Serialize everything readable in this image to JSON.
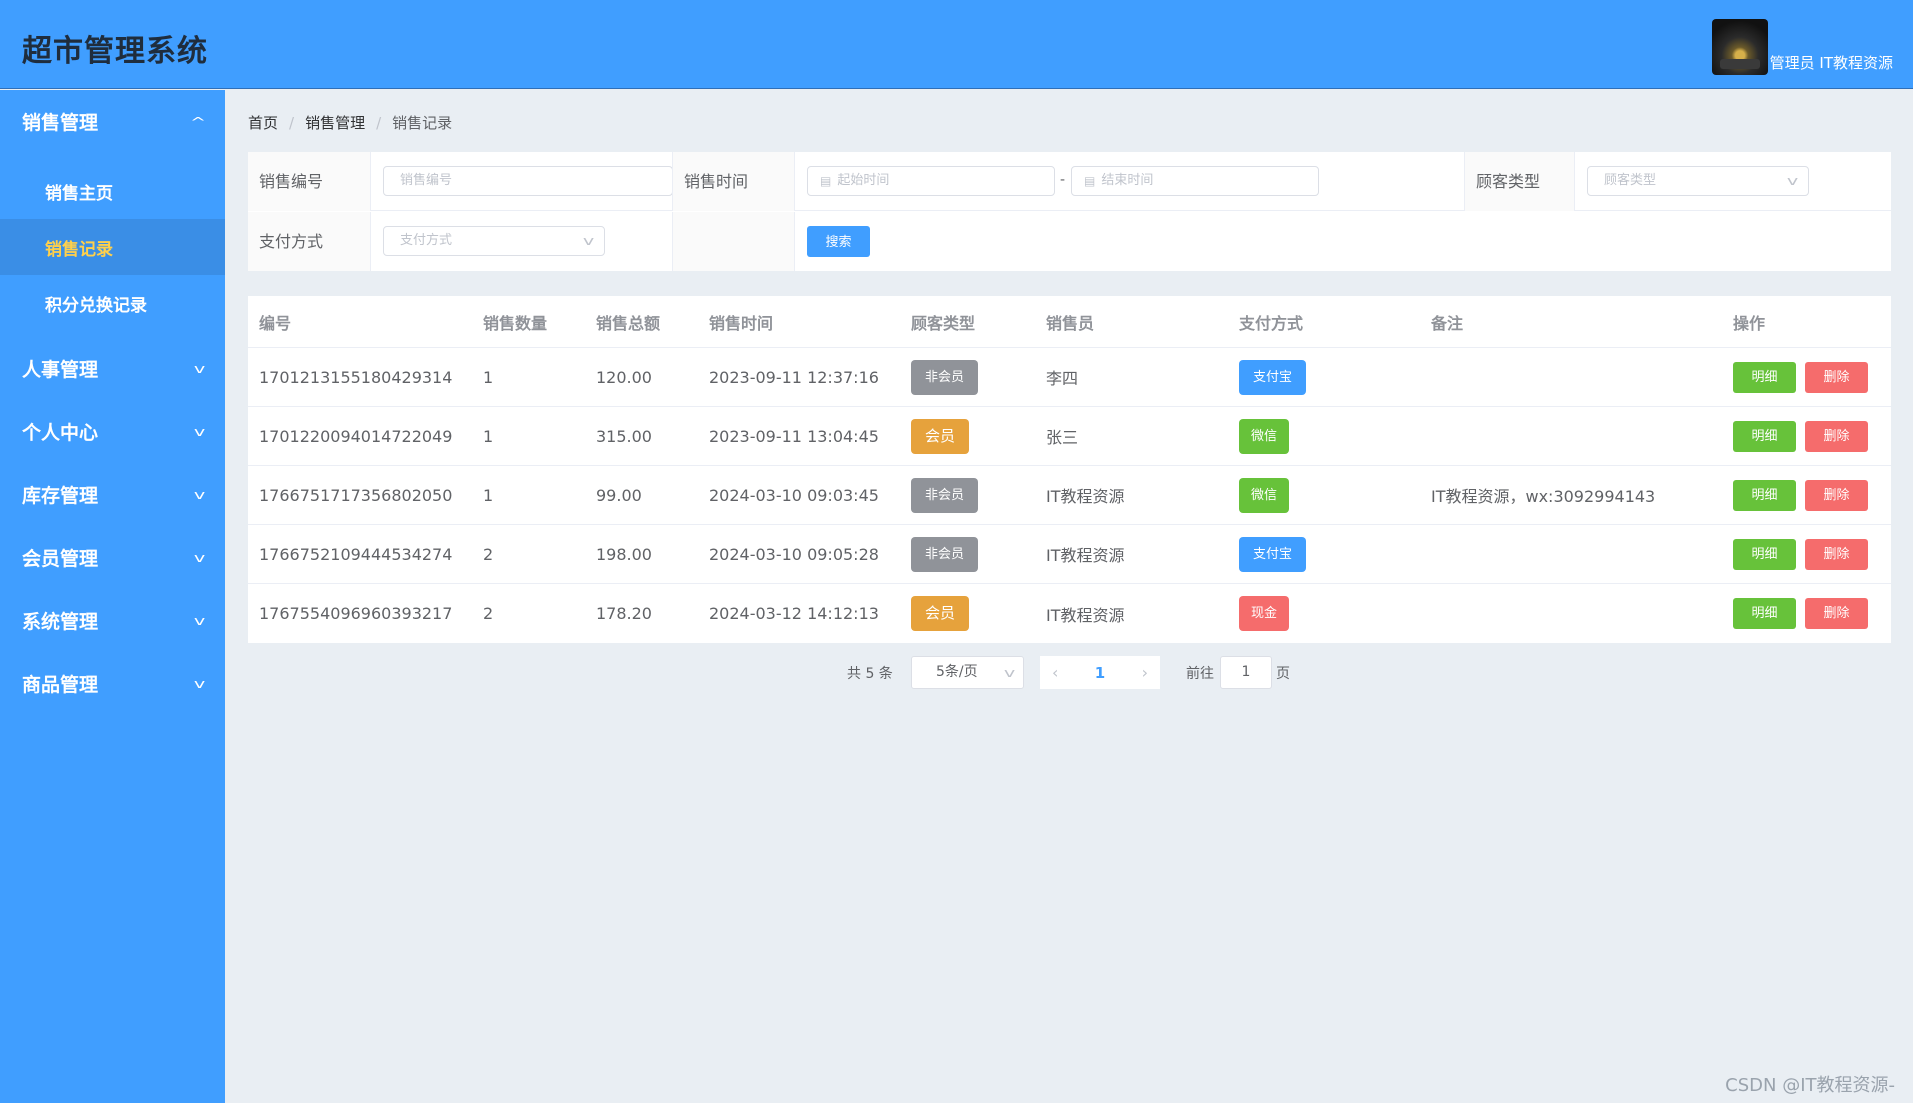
{
  "header": {
    "title": "超市管理系统",
    "user_name": "管理员 IT教程资源"
  },
  "sidebar": {
    "groups": [
      {
        "label": "销售管理",
        "expanded": true,
        "items": [
          {
            "label": "销售主页",
            "active": false
          },
          {
            "label": "销售记录",
            "active": true
          },
          {
            "label": "积分兑换记录",
            "active": false
          }
        ]
      },
      {
        "label": "人事管理",
        "expanded": false
      },
      {
        "label": "个人中心",
        "expanded": false
      },
      {
        "label": "库存管理",
        "expanded": false
      },
      {
        "label": "会员管理",
        "expanded": false
      },
      {
        "label": "系统管理",
        "expanded": false
      },
      {
        "label": "商品管理",
        "expanded": false
      }
    ]
  },
  "breadcrumb": [
    "首页",
    "销售管理",
    "销售记录"
  ],
  "search": {
    "sale_no_label": "销售编号",
    "sale_no_placeholder": "销售编号",
    "sale_time_label": "销售时间",
    "start_placeholder": "起始时间",
    "end_placeholder": "结束时间",
    "range_sep": "-",
    "customer_type_label": "顾客类型",
    "customer_type_placeholder": "顾客类型",
    "pay_method_label": "支付方式",
    "pay_method_placeholder": "支付方式",
    "search_button": "搜索"
  },
  "table": {
    "columns": [
      "编号",
      "销售数量",
      "销售总额",
      "销售时间",
      "顾客类型",
      "销售员",
      "支付方式",
      "备注",
      "操作"
    ],
    "rows": [
      {
        "id": "1701213155180429314",
        "qty": "1",
        "total": "120.00",
        "time": "2023-09-11 12:37:16",
        "customer_type": "非会员",
        "seller": "李四",
        "pay": "支付宝",
        "note": ""
      },
      {
        "id": "1701220094014722049",
        "qty": "1",
        "total": "315.00",
        "time": "2023-09-11 13:04:45",
        "customer_type": "会员",
        "seller": "张三",
        "pay": "微信",
        "note": ""
      },
      {
        "id": "1766751717356802050",
        "qty": "1",
        "total": "99.00",
        "time": "2024-03-10 09:03:45",
        "customer_type": "非会员",
        "seller": "IT教程资源",
        "pay": "微信",
        "note": "IT教程资源，wx:3092994143"
      },
      {
        "id": "1766752109444534274",
        "qty": "2",
        "total": "198.00",
        "time": "2024-03-10 09:05:28",
        "customer_type": "非会员",
        "seller": "IT教程资源",
        "pay": "支付宝",
        "note": ""
      },
      {
        "id": "1767554096960393217",
        "qty": "2",
        "total": "178.20",
        "time": "2024-03-12 14:12:13",
        "customer_type": "会员",
        "seller": "IT教程资源",
        "pay": "现金",
        "note": ""
      }
    ],
    "detail_button": "明细",
    "delete_button": "删除"
  },
  "pagination": {
    "total_text": "共 5 条",
    "page_size": "5条/页",
    "current_page": "1",
    "goto_label": "前往",
    "goto_value": "1",
    "page_unit": "页"
  },
  "watermark": "CSDN @IT教程资源-",
  "colors": {
    "primary": "#409eff",
    "active_text": "#ffd04b",
    "success": "#67c23a",
    "danger": "#f56c6c",
    "warning": "#e6a23c",
    "info": "#909399",
    "background": "#e9eef3"
  }
}
